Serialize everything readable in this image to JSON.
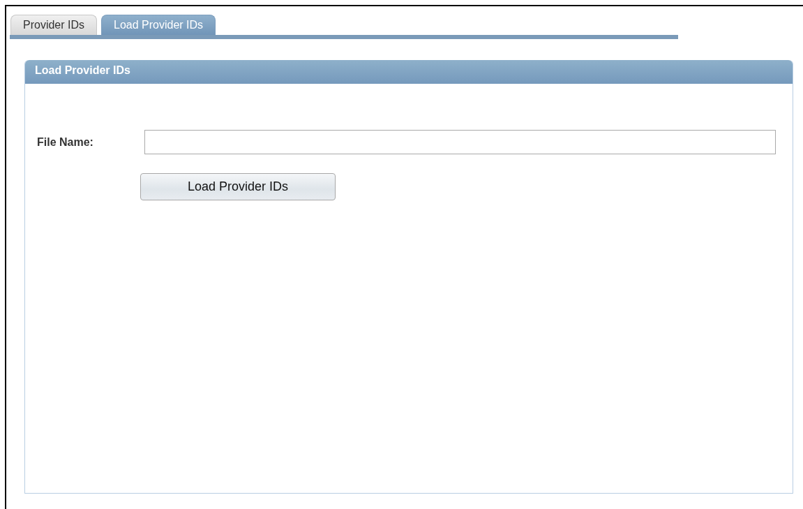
{
  "tabs": [
    {
      "label": "Provider IDs",
      "selected": false
    },
    {
      "label": "Load Provider IDs",
      "selected": true
    }
  ],
  "panel": {
    "title": "Load Provider IDs",
    "file_name": {
      "label": "File Name:"
    },
    "button": "Load Provider IDs"
  }
}
